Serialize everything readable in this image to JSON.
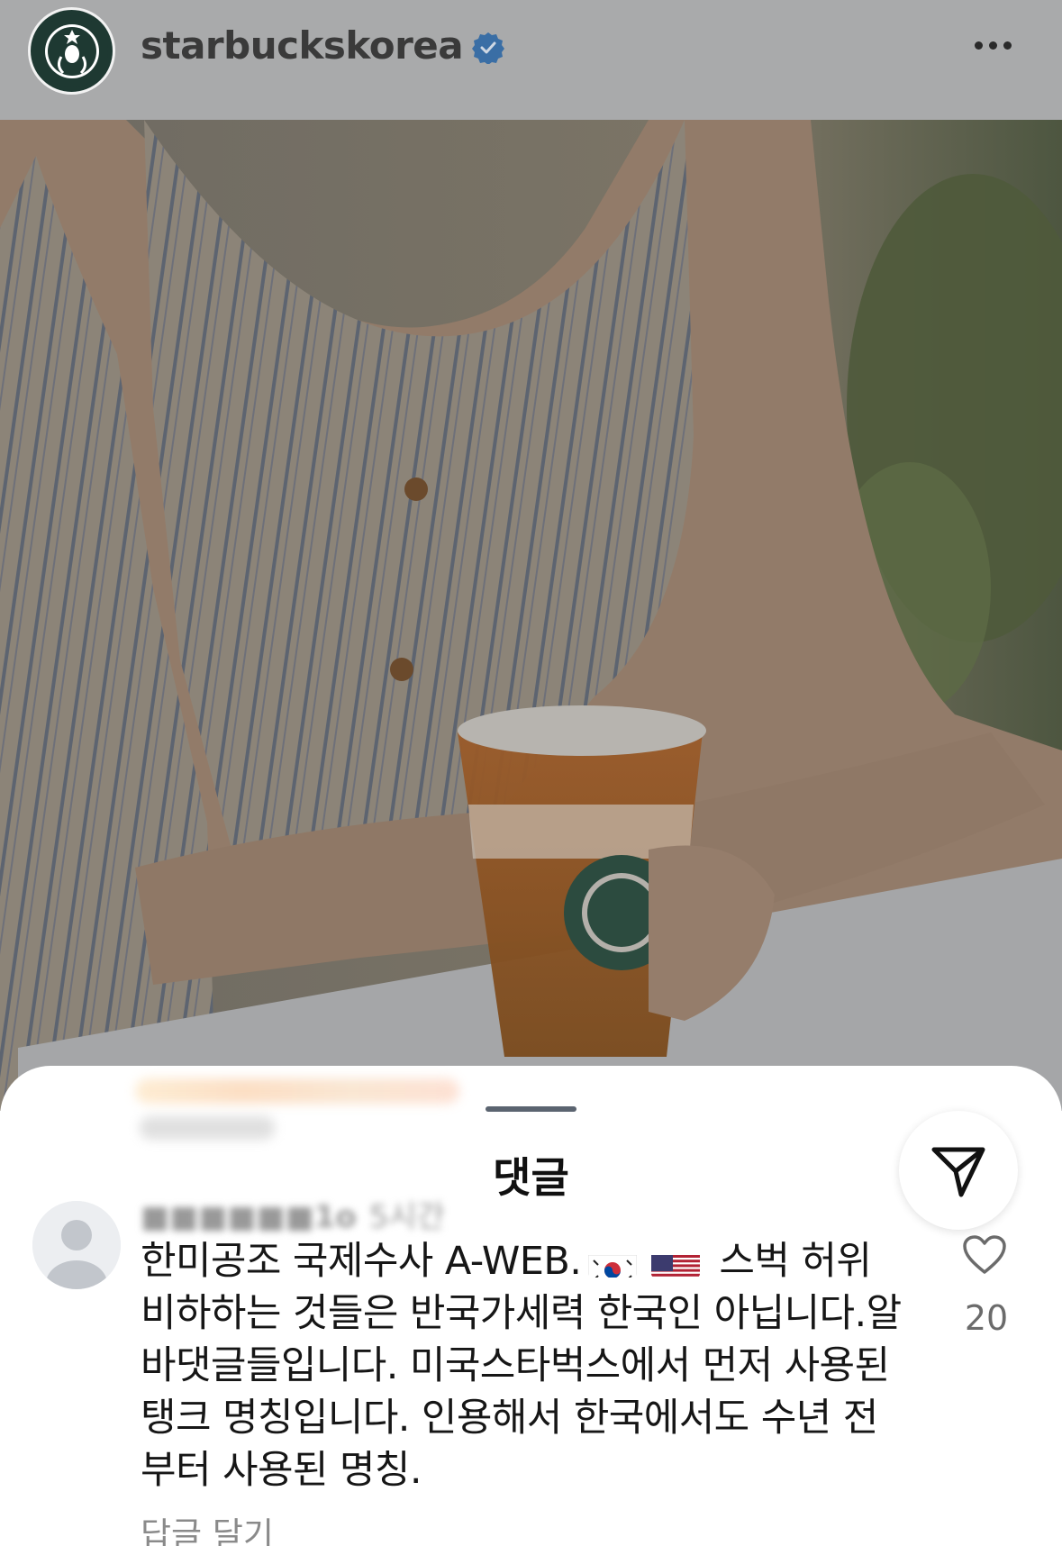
{
  "header": {
    "username": "starbuckskorea",
    "verified": true,
    "avatar_icon": "starbucks-logo",
    "more_icon": "more-horizontal-icon"
  },
  "post": {
    "image": "woman-holding-starbucks-iced-tea"
  },
  "comments_sheet": {
    "title": "댓글",
    "share_icon": "send-icon",
    "comment": {
      "username": "■■■■■■1o",
      "time": "5시간",
      "text_before_flags": "한미공조 국제수사 A-WEB.",
      "flags": [
        "south-korea-flag",
        "usa-flag"
      ],
      "text_after_flags": "스벅 허위비하하는 것들은 반국가세력 한국인 아닙니다.알바댓글들입니다. 미국스타벅스에서 먼저 사용된  탱크 명칭입니다. 인용해서 한국에서도 수년 전부터 사용된 명칭.",
      "like_count": "20",
      "reply_label": "답글 달기"
    }
  },
  "colors": {
    "overlay_dim": "#a9aaab",
    "starbucks_green": "#1e3932",
    "verified_blue": "#0095f6"
  }
}
